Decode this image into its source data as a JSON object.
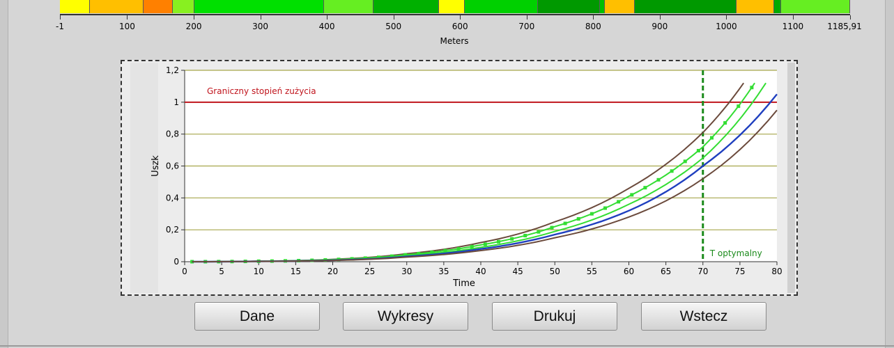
{
  "colors": {
    "background": "#d6d6d6",
    "limit_line": "#c0141c",
    "optimal_line": "#1a8a1a",
    "blue_curve": "#1f3fbf",
    "green_curve": "#33dd33",
    "brown_curve": "#6b4a3c",
    "grid": "#a6a64a"
  },
  "scale": {
    "title": "Meters",
    "tick_labels": [
      "-1",
      "100",
      "200",
      "300",
      "400",
      "500",
      "600",
      "700",
      "800",
      "900",
      "1000",
      "1100",
      "1185,91"
    ],
    "min": -1,
    "max": 1185.91,
    "segments": [
      {
        "from": -1,
        "to": 44,
        "color": "#ffff00"
      },
      {
        "from": 44,
        "to": 125,
        "color": "#ffbf00"
      },
      {
        "from": 125,
        "to": 169,
        "color": "#ff8000"
      },
      {
        "from": 169,
        "to": 201,
        "color": "#88f020"
      },
      {
        "from": 201,
        "to": 396,
        "color": "#00e000"
      },
      {
        "from": 396,
        "to": 470,
        "color": "#66ee22"
      },
      {
        "from": 470,
        "to": 568,
        "color": "#00b000"
      },
      {
        "from": 568,
        "to": 607,
        "color": "#ffff00"
      },
      {
        "from": 607,
        "to": 717,
        "color": "#00d000"
      },
      {
        "from": 717,
        "to": 810,
        "color": "#009900"
      },
      {
        "from": 810,
        "to": 817,
        "color": "#00c000"
      },
      {
        "from": 817,
        "to": 863,
        "color": "#ffbf00"
      },
      {
        "from": 863,
        "to": 1015,
        "color": "#009900"
      },
      {
        "from": 1015,
        "to": 1072,
        "color": "#ffbf00"
      },
      {
        "from": 1072,
        "to": 1082,
        "color": "#00aa00"
      },
      {
        "from": 1082,
        "to": 1185.91,
        "color": "#66ee22"
      }
    ]
  },
  "chart_data": {
    "type": "line",
    "xlabel": "Time",
    "ylabel": "Uszk",
    "xlim": [
      0,
      80
    ],
    "ylim": [
      0,
      1.2
    ],
    "x_ticks": [
      "0",
      "5",
      "10",
      "15",
      "20",
      "25",
      "30",
      "35",
      "40",
      "45",
      "50",
      "55",
      "60",
      "65",
      "70",
      "75",
      "80"
    ],
    "y_ticks": [
      "0",
      "0,2",
      "0,4",
      "0,6",
      "0,8",
      "1",
      "1,2"
    ],
    "grid": "horizontal",
    "limit_line": {
      "label": "Graniczny stopień zużycia",
      "value": 1.0
    },
    "optimal_line": {
      "label": "T optymalny",
      "value": 70
    },
    "series": [
      {
        "style": "brown",
        "x": [
          1,
          10,
          20,
          30,
          40,
          50,
          60,
          70,
          75.5
        ],
        "y": [
          0,
          0.003,
          0.015,
          0.05,
          0.12,
          0.25,
          0.46,
          0.81,
          1.12
        ]
      },
      {
        "style": "green-dotted",
        "x": [
          1,
          10,
          20,
          30,
          40,
          50,
          60,
          70,
          77
        ],
        "y": [
          0,
          0.003,
          0.013,
          0.044,
          0.105,
          0.22,
          0.41,
          0.72,
          1.12
        ]
      },
      {
        "style": "green",
        "x": [
          1,
          10,
          20,
          30,
          40,
          50,
          60,
          70,
          78.5
        ],
        "y": [
          0,
          0.002,
          0.011,
          0.038,
          0.09,
          0.19,
          0.36,
          0.65,
          1.12
        ]
      },
      {
        "style": "blue",
        "x": [
          1,
          10,
          20,
          30,
          40,
          50,
          60,
          70,
          80
        ],
        "y": [
          0,
          0.002,
          0.009,
          0.033,
          0.08,
          0.17,
          0.32,
          0.6,
          1.05
        ]
      },
      {
        "style": "brown",
        "x": [
          1,
          10,
          20,
          30,
          40,
          50,
          60,
          70,
          80
        ],
        "y": [
          0,
          0.002,
          0.008,
          0.029,
          0.07,
          0.15,
          0.28,
          0.52,
          0.95
        ]
      }
    ]
  },
  "buttons": {
    "dane": "Dane",
    "wykresy": "Wykresy",
    "drukuj": "Drukuj",
    "wstecz": "Wstecz"
  }
}
